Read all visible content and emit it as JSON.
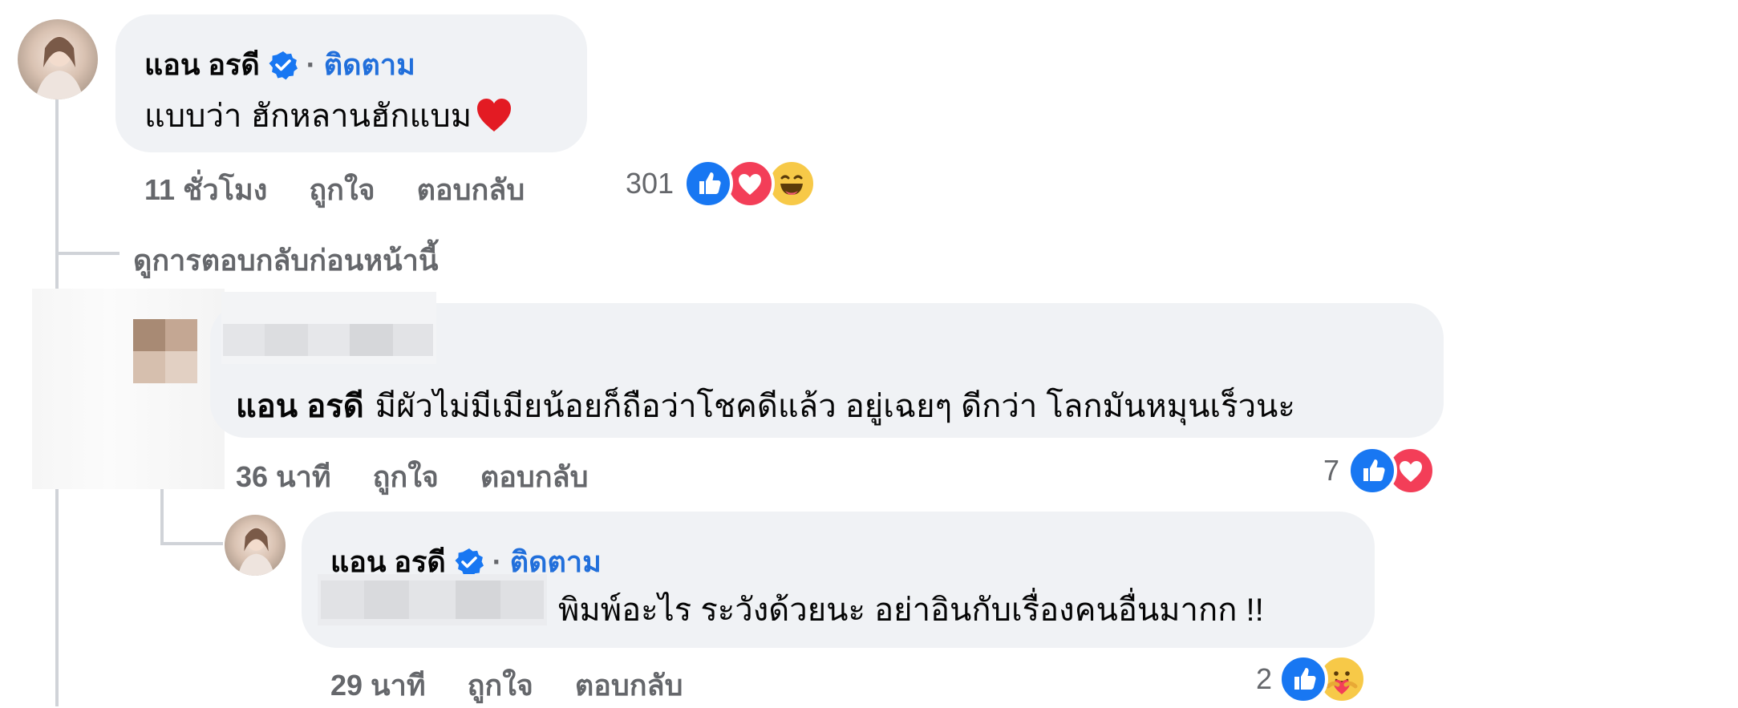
{
  "comments": [
    {
      "author": "แอน อรดี",
      "follow_label": "ติดตาม",
      "text": "แบบว่า ฮักหลานฮักแบม",
      "emoji": "❤️",
      "time": "11 ชั่วโมง",
      "like_label": "ถูกใจ",
      "reply_label": "ตอบกลับ",
      "reaction_count": "301"
    },
    {
      "author_mention": "แอน อรดี",
      "text": "มีผัวไม่มีเมียน้อยก็ถือว่าโชคดีแล้ว อยู่เฉยๆ ดีกว่า โลกมันหมุนเร็วนะ",
      "time": "36 นาที",
      "like_label": "ถูกใจ",
      "reply_label": "ตอบกลับ",
      "reaction_count": "7"
    },
    {
      "author": "แอน อรดี",
      "follow_label": "ติดตาม",
      "text": "พิมพ์อะไร ระวังด้วยนะ อย่าอินกับเรื่องคนอื่นมากก !!",
      "time": "29 นาที",
      "like_label": "ถูกใจ",
      "reply_label": "ตอบกลับ",
      "reaction_count": "2"
    }
  ],
  "view_previous_replies": "ดูการตอบกลับก่อนหน้านี้",
  "colors": {
    "bubble": "#f0f2f5",
    "link": "#216fdb",
    "meta": "#65676b",
    "like": "#1877f2",
    "love": "#f33e58"
  }
}
